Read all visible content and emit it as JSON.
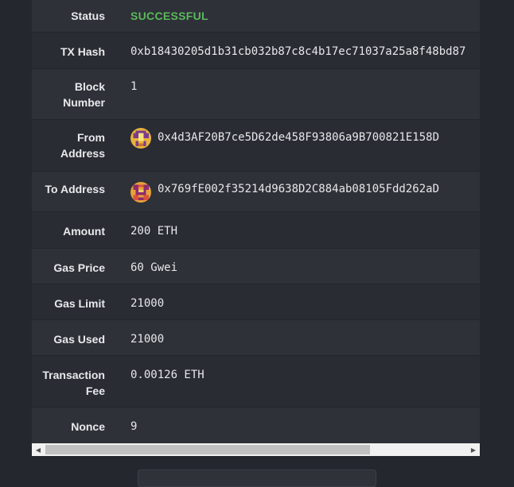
{
  "transaction": {
    "status": {
      "label": "Status",
      "value": "SUCCESSFUL"
    },
    "tx_hash": {
      "label": "TX Hash",
      "value": "0xb18430205d1b31cb032b87c8c4b17ec71037a25a8f48bd87"
    },
    "block_number": {
      "label_line1": "Block",
      "label_line2": "Number",
      "value": "1"
    },
    "from_address": {
      "label_line1": "From",
      "label_line2": "Address",
      "value": "0x4d3AF20B7ce5D62de458F93806a9B700821E158D"
    },
    "to_address": {
      "label": "To Address",
      "value": "0x769fE002f35214d9638D2C884ab08105Fdd262aD"
    },
    "amount": {
      "label": "Amount",
      "value": "200 ETH"
    },
    "gas_price": {
      "label": "Gas Price",
      "value": "60 Gwei"
    },
    "gas_limit": {
      "label": "Gas Limit",
      "value": "21000"
    },
    "gas_used": {
      "label": "Gas Used",
      "value": "21000"
    },
    "transaction_fee": {
      "label_line1": "Transaction",
      "label_line2": "Fee",
      "value": "0.00126 ETH"
    },
    "nonce": {
      "label": "Nonce",
      "value": "9"
    }
  },
  "colors": {
    "status_success": "#5cb85c",
    "row_even": "#2e3138",
    "row_odd": "#292c33",
    "background": "#24272e"
  },
  "icons": {
    "from_avatar": "identicon-avatar-icon",
    "to_avatar": "identicon-avatar-icon",
    "scroll_left": "triangle-left-icon",
    "scroll_right": "triangle-right-icon"
  }
}
